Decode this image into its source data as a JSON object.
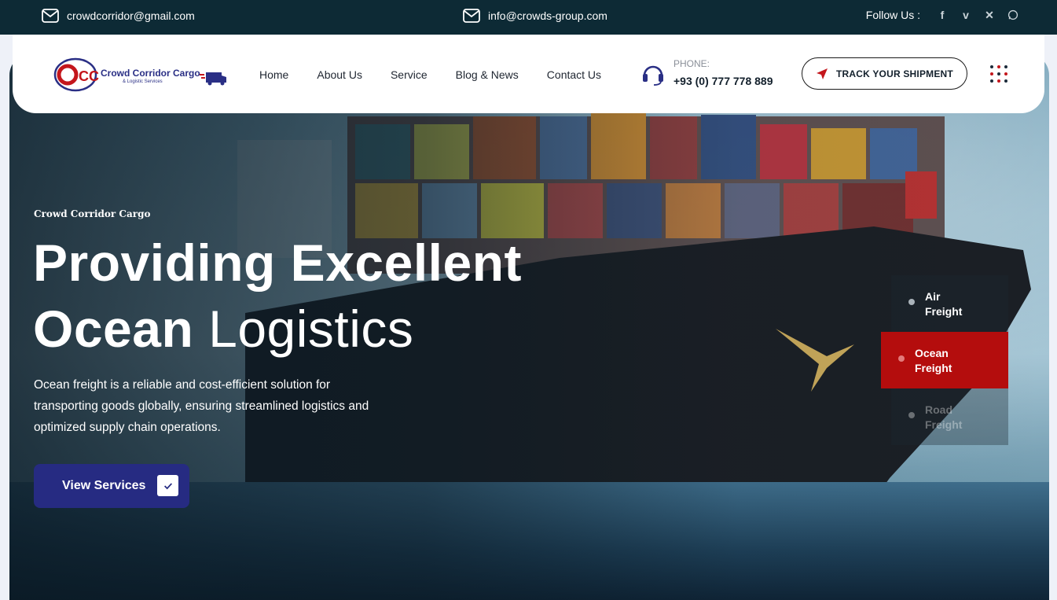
{
  "topbar": {
    "email_1": "crowdcorridor@gmail.com",
    "email_2": "info@crowds-group.com",
    "follow_label": "Follow Us :",
    "social": [
      "facebook-icon",
      "vimeo-icon",
      "x-icon",
      "whatsapp-icon"
    ]
  },
  "logo": {
    "name": "Crowd Corridor Cargo",
    "sub": "& Logistic Services",
    "mark_text": "CC"
  },
  "nav": {
    "items": [
      "Home",
      "About Us",
      "Service",
      "Blog & News",
      "Contact Us"
    ]
  },
  "phone": {
    "label": "PHONE:",
    "number": "+93 (0) 777 778 889"
  },
  "track_button": "TRACK YOUR SHIPMENT",
  "hero": {
    "kicker": "Crowd Corridor Cargo",
    "title_line1": "Providing Excellent",
    "title_line2_bold": "Ocean",
    "title_line2_light": "Logistics",
    "description": "Ocean freight is a reliable and cost-efficient solution for transporting goods globally, ensuring streamlined logistics and optimized supply chain operations.",
    "cta": "View Services"
  },
  "tabs": [
    {
      "label": "Air Freight",
      "line1": "Air",
      "line2": "Freight",
      "active": false
    },
    {
      "label": "Ocean Freight",
      "line1": "Ocean",
      "line2": "Freight",
      "active": true
    },
    {
      "label": "Road Freight",
      "line1": "Road",
      "line2": "Freight",
      "active": false
    }
  ],
  "colors": {
    "topbar": "#0d2a35",
    "brand_blue": "#262b82",
    "brand_red": "#b40d0d"
  }
}
